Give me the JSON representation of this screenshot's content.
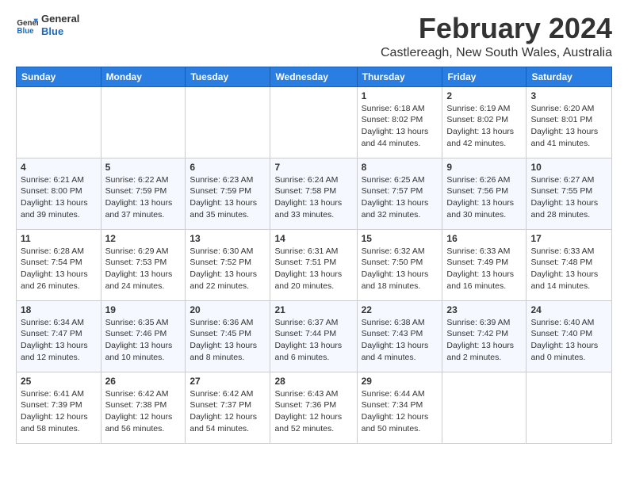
{
  "logo": {
    "text_general": "General",
    "text_blue": "Blue"
  },
  "header": {
    "month": "February 2024",
    "location": "Castlereagh, New South Wales, Australia"
  },
  "weekdays": [
    "Sunday",
    "Monday",
    "Tuesday",
    "Wednesday",
    "Thursday",
    "Friday",
    "Saturday"
  ],
  "weeks": [
    [
      {
        "day": "",
        "detail": ""
      },
      {
        "day": "",
        "detail": ""
      },
      {
        "day": "",
        "detail": ""
      },
      {
        "day": "",
        "detail": ""
      },
      {
        "day": "1",
        "detail": "Sunrise: 6:18 AM\nSunset: 8:02 PM\nDaylight: 13 hours\nand 44 minutes."
      },
      {
        "day": "2",
        "detail": "Sunrise: 6:19 AM\nSunset: 8:02 PM\nDaylight: 13 hours\nand 42 minutes."
      },
      {
        "day": "3",
        "detail": "Sunrise: 6:20 AM\nSunset: 8:01 PM\nDaylight: 13 hours\nand 41 minutes."
      }
    ],
    [
      {
        "day": "4",
        "detail": "Sunrise: 6:21 AM\nSunset: 8:00 PM\nDaylight: 13 hours\nand 39 minutes."
      },
      {
        "day": "5",
        "detail": "Sunrise: 6:22 AM\nSunset: 7:59 PM\nDaylight: 13 hours\nand 37 minutes."
      },
      {
        "day": "6",
        "detail": "Sunrise: 6:23 AM\nSunset: 7:59 PM\nDaylight: 13 hours\nand 35 minutes."
      },
      {
        "day": "7",
        "detail": "Sunrise: 6:24 AM\nSunset: 7:58 PM\nDaylight: 13 hours\nand 33 minutes."
      },
      {
        "day": "8",
        "detail": "Sunrise: 6:25 AM\nSunset: 7:57 PM\nDaylight: 13 hours\nand 32 minutes."
      },
      {
        "day": "9",
        "detail": "Sunrise: 6:26 AM\nSunset: 7:56 PM\nDaylight: 13 hours\nand 30 minutes."
      },
      {
        "day": "10",
        "detail": "Sunrise: 6:27 AM\nSunset: 7:55 PM\nDaylight: 13 hours\nand 28 minutes."
      }
    ],
    [
      {
        "day": "11",
        "detail": "Sunrise: 6:28 AM\nSunset: 7:54 PM\nDaylight: 13 hours\nand 26 minutes."
      },
      {
        "day": "12",
        "detail": "Sunrise: 6:29 AM\nSunset: 7:53 PM\nDaylight: 13 hours\nand 24 minutes."
      },
      {
        "day": "13",
        "detail": "Sunrise: 6:30 AM\nSunset: 7:52 PM\nDaylight: 13 hours\nand 22 minutes."
      },
      {
        "day": "14",
        "detail": "Sunrise: 6:31 AM\nSunset: 7:51 PM\nDaylight: 13 hours\nand 20 minutes."
      },
      {
        "day": "15",
        "detail": "Sunrise: 6:32 AM\nSunset: 7:50 PM\nDaylight: 13 hours\nand 18 minutes."
      },
      {
        "day": "16",
        "detail": "Sunrise: 6:33 AM\nSunset: 7:49 PM\nDaylight: 13 hours\nand 16 minutes."
      },
      {
        "day": "17",
        "detail": "Sunrise: 6:33 AM\nSunset: 7:48 PM\nDaylight: 13 hours\nand 14 minutes."
      }
    ],
    [
      {
        "day": "18",
        "detail": "Sunrise: 6:34 AM\nSunset: 7:47 PM\nDaylight: 13 hours\nand 12 minutes."
      },
      {
        "day": "19",
        "detail": "Sunrise: 6:35 AM\nSunset: 7:46 PM\nDaylight: 13 hours\nand 10 minutes."
      },
      {
        "day": "20",
        "detail": "Sunrise: 6:36 AM\nSunset: 7:45 PM\nDaylight: 13 hours\nand 8 minutes."
      },
      {
        "day": "21",
        "detail": "Sunrise: 6:37 AM\nSunset: 7:44 PM\nDaylight: 13 hours\nand 6 minutes."
      },
      {
        "day": "22",
        "detail": "Sunrise: 6:38 AM\nSunset: 7:43 PM\nDaylight: 13 hours\nand 4 minutes."
      },
      {
        "day": "23",
        "detail": "Sunrise: 6:39 AM\nSunset: 7:42 PM\nDaylight: 13 hours\nand 2 minutes."
      },
      {
        "day": "24",
        "detail": "Sunrise: 6:40 AM\nSunset: 7:40 PM\nDaylight: 13 hours\nand 0 minutes."
      }
    ],
    [
      {
        "day": "25",
        "detail": "Sunrise: 6:41 AM\nSunset: 7:39 PM\nDaylight: 12 hours\nand 58 minutes."
      },
      {
        "day": "26",
        "detail": "Sunrise: 6:42 AM\nSunset: 7:38 PM\nDaylight: 12 hours\nand 56 minutes."
      },
      {
        "day": "27",
        "detail": "Sunrise: 6:42 AM\nSunset: 7:37 PM\nDaylight: 12 hours\nand 54 minutes."
      },
      {
        "day": "28",
        "detail": "Sunrise: 6:43 AM\nSunset: 7:36 PM\nDaylight: 12 hours\nand 52 minutes."
      },
      {
        "day": "29",
        "detail": "Sunrise: 6:44 AM\nSunset: 7:34 PM\nDaylight: 12 hours\nand 50 minutes."
      },
      {
        "day": "",
        "detail": ""
      },
      {
        "day": "",
        "detail": ""
      }
    ]
  ]
}
